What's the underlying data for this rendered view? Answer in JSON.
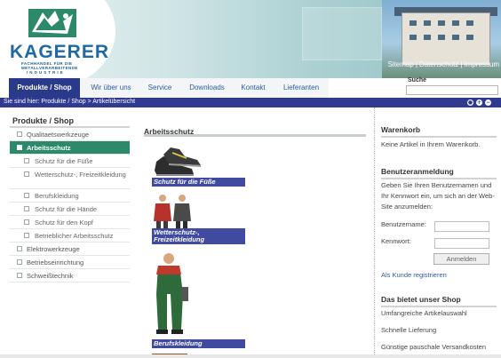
{
  "brand": {
    "name": "KAGERER",
    "sub_line1": "FACHHANDEL FÜR DIE",
    "sub_line2": "METALLVERARBEITENDE",
    "sub_line3": "I N D U S T R I E",
    "brand_color": "#1d6aa6",
    "accent_green": "#2c8a6a"
  },
  "top_links": [
    "Sitemap",
    "Datenschutz",
    "Impressum"
  ],
  "search": {
    "label": "Suche",
    "value": ""
  },
  "nav": {
    "items": [
      "Produkte / Shop",
      "Wir über uns",
      "Service",
      "Downloads",
      "Kontakt",
      "Lieferanten"
    ],
    "active_index": 0,
    "active_color": "#2a3a8a"
  },
  "breadcrumb": {
    "text": "Sie sind hier: Produkte / Shop > Artikelübersicht",
    "controls": [
      "gear-icon",
      "plus-icon",
      "minus-icon"
    ]
  },
  "sidebar": {
    "title": "Produkte / Shop",
    "items": [
      {
        "label": "Qualitaetswerkzeuge",
        "level": 0,
        "active": false
      },
      {
        "label": "Arbeitsschutz",
        "level": 0,
        "active": true
      },
      {
        "label": "Schutz für die Füße",
        "level": 1,
        "active": false
      },
      {
        "label": "Wetterschutz-, Freizeitkleidung",
        "level": 1,
        "active": false
      },
      {
        "label": "Berufskleidung",
        "level": 1,
        "active": false
      },
      {
        "label": "Schutz für die Hände",
        "level": 1,
        "active": false
      },
      {
        "label": "Schutz für den Kopf",
        "level": 1,
        "active": false
      },
      {
        "label": "Betrieblicher Arbeitsschutz",
        "level": 1,
        "active": false
      },
      {
        "label": "Elektrowerkzeuge",
        "level": 0,
        "active": false
      },
      {
        "label": "Betriebseinrichtung",
        "level": 0,
        "active": false
      },
      {
        "label": "Schweißtechnik",
        "level": 0,
        "active": false
      }
    ]
  },
  "main": {
    "title": "Arbeitsschutz",
    "products": [
      {
        "label": "Schutz für die Füße",
        "image": "safety-shoes-image"
      },
      {
        "label": "Wetterschutz-, Freizeitkleidung",
        "image": "weather-clothing-image"
      },
      {
        "label": "Berufskleidung",
        "image": "workwear-image"
      }
    ]
  },
  "cart": {
    "title": "Warenkorb",
    "text": "Keine Artikel in Ihrem Warenkorb."
  },
  "login": {
    "title": "Benutzeranmeldung",
    "intro": "Geben Sie Ihren Benutzernamen und Ihr Kennwort ein, um sich an der Web-Site anzumelden:",
    "username_label": "Benutzername:",
    "password_label": "Kennwort:",
    "button_label": "Anmelden",
    "register_link": "Als Kunde registrieren"
  },
  "shop_benefits": {
    "title": "Das bietet unser Shop",
    "items": [
      "Umfangreiche Artikelauswahl",
      "Schnelle Lieferung",
      "Günstige pauschale Versandkosten"
    ]
  }
}
